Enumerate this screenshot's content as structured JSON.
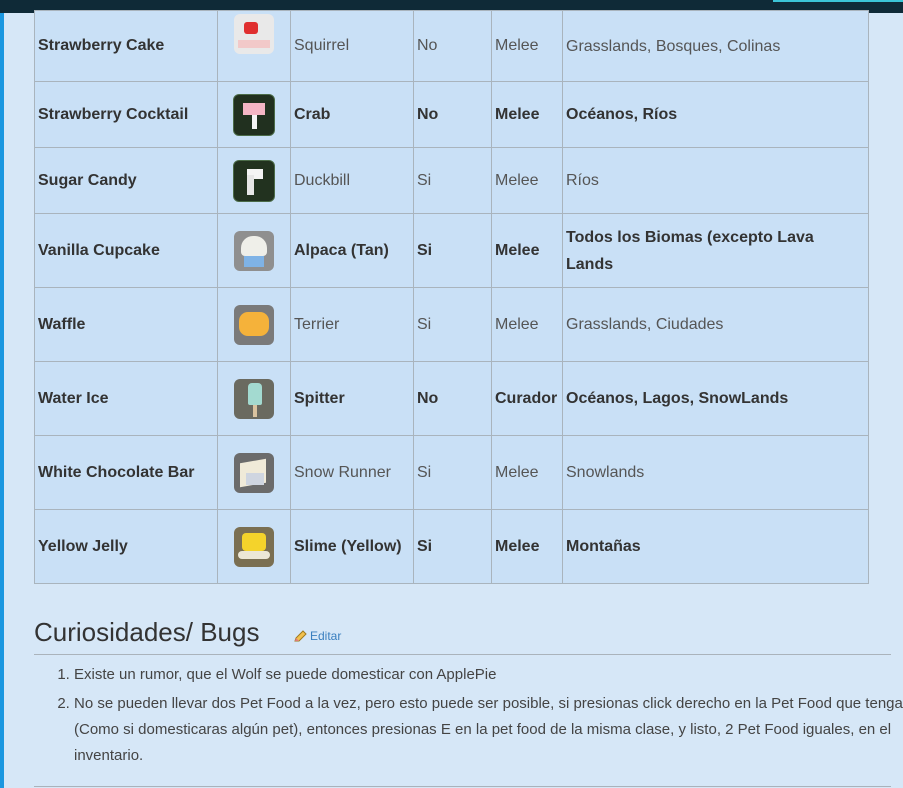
{
  "rows": [
    {
      "food": "Strawberry Cake",
      "icon": "strawberry-cake-icon",
      "pet": "Squirrel",
      "tameable": "No",
      "type": "Melee",
      "biomes": "Grasslands, Bosques, Colinas"
    },
    {
      "food": "Strawberry Cocktail",
      "icon": "strawberry-cocktail-icon",
      "pet": "Crab",
      "tameable": "No",
      "type": "Melee",
      "biomes": "Océanos, Ríos"
    },
    {
      "food": "Sugar Candy",
      "icon": "sugar-candy-icon",
      "pet": "Duckbill",
      "tameable": "Si",
      "type": "Melee",
      "biomes": "Ríos"
    },
    {
      "food": "Vanilla Cupcake",
      "icon": "vanilla-cupcake-icon",
      "pet": "Alpaca (Tan)",
      "tameable": "Si",
      "type": "Melee",
      "biomes": "Todos los Biomas (excepto Lava Lands"
    },
    {
      "food": "Waffle",
      "icon": "waffle-icon",
      "pet": "Terrier",
      "tameable": "Si",
      "type": "Melee",
      "biomes": "Grasslands, Ciudades"
    },
    {
      "food": "Water Ice",
      "icon": "water-ice-icon",
      "pet": "Spitter",
      "tameable": "No",
      "type": "Curador",
      "biomes": "Océanos, Lagos, SnowLands"
    },
    {
      "food": "White Chocolate Bar",
      "icon": "white-chocolate-bar-icon",
      "pet": "Snow Runner",
      "tameable": "Si",
      "type": "Melee",
      "biomes": "Snowlands"
    },
    {
      "food": "Yellow Jelly",
      "icon": "yellow-jelly-icon",
      "pet": "Slime (Yellow)",
      "tameable": "Si",
      "type": "Melee",
      "biomes": "Montañas"
    }
  ],
  "section": {
    "title": "Curiosidades/ Bugs",
    "edit_label": "Editar",
    "edit_icon": "pencil-icon"
  },
  "bugs": [
    "Existe un rumor, que el Wolf se puede domesticar con ApplePie",
    "No se pueden llevar dos Pet Food a la vez, pero esto puede ser posible, si presionas click derecho en la Pet Food que tengas (Como si domesticaras algún pet), entonces presionas E en la pet food de la misma clase, y listo, 2 Pet Food iguales, en el inventario."
  ],
  "colors": {
    "page_bg": "#d6e7f7",
    "table_bg": "#c9e0f6",
    "topbar": "#0f2a37",
    "accent": "#3cc4d6",
    "link": "#3a7fbf"
  }
}
